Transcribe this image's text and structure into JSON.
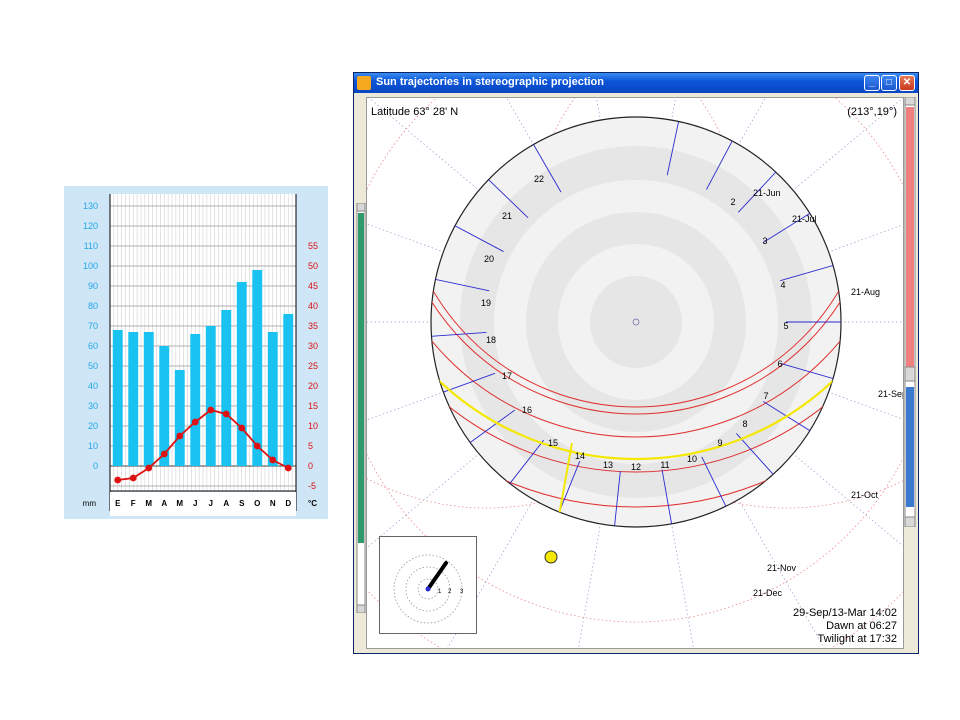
{
  "climate_chart": {
    "left_axis_ticks": [
      "130",
      "120",
      "110",
      "100",
      "90",
      "80",
      "70",
      "60",
      "50",
      "40",
      "30",
      "20",
      "10",
      "0"
    ],
    "right_axis_ticks": [
      "55",
      "50",
      "45",
      "40",
      "35",
      "30",
      "25",
      "20",
      "15",
      "10",
      "5",
      "0",
      "-5"
    ],
    "left_unit": "mm",
    "right_unit": "°C",
    "months": [
      "E",
      "F",
      "M",
      "A",
      "M",
      "J",
      "J",
      "A",
      "S",
      "O",
      "N",
      "D"
    ],
    "colors": {
      "bar": "#1ac2f1",
      "line": "#dd1111",
      "left_axis_text": "#22a6e8",
      "right_axis_text": "#dd1111"
    },
    "chart_data": {
      "type": "bar",
      "categories": [
        "E",
        "F",
        "M",
        "A",
        "M",
        "J",
        "J",
        "A",
        "S",
        "O",
        "N",
        "D"
      ],
      "series": [
        {
          "values": [
            68,
            67,
            67,
            60,
            48,
            66,
            70,
            78,
            92,
            98,
            67,
            76
          ]
        },
        {
          "values": [
            -3.5,
            -3,
            -0.5,
            3,
            7.5,
            11,
            14,
            13,
            9.5,
            5,
            1.5,
            -0.5
          ]
        }
      ],
      "ylim_left": [
        -10,
        130
      ],
      "ylim_right": [
        -5,
        55
      ]
    }
  },
  "window": {
    "title": "Sun trajectories in stereographic projection",
    "minimize": "_",
    "maximize": "□",
    "close": "✕",
    "latitude_label": "Latitude 63° 28' N",
    "cursor_readout": "(213°,19°)",
    "date_time": "29-Sep/13-Mar 14:02",
    "dawn": "Dawn at 06:27",
    "twilight": "Twilight at 17:32",
    "hour_labels": [
      "22",
      "21",
      "20",
      "19",
      "18",
      "17",
      "16",
      "15",
      "14",
      "13",
      "12",
      "11",
      "10",
      "9",
      "8",
      "7",
      "6",
      "5",
      "4",
      "3",
      "2"
    ],
    "date_labels": [
      "21-Jun",
      "21-Jul",
      "21-Aug",
      "21-Sep",
      "21-Oct",
      "21-Nov",
      "21-Dec"
    ],
    "inset_labels": [
      "1",
      "2",
      "3"
    ],
    "colors": {
      "declination": "#e03030",
      "hour_lines": "#2a2ad0",
      "selected": "#f5e800",
      "slider_left": "#2f9a6a",
      "slider_right_top": "#f08080",
      "slider_right_bottom": "#3a7ad0"
    }
  }
}
